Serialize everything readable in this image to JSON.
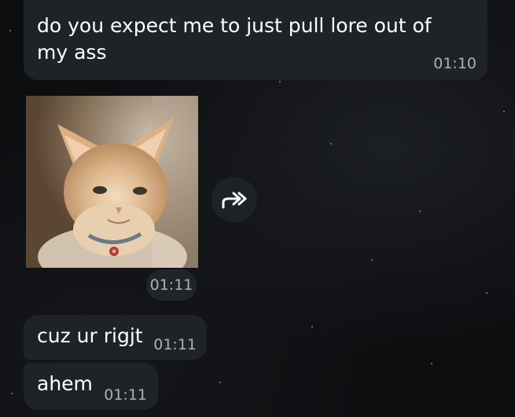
{
  "messages": [
    {
      "text": "do you expect me to just pull lore out of my ass",
      "time": "01:10"
    },
    {
      "time": "01:11"
    },
    {
      "text": "cuz ur rigjt",
      "time": "01:11"
    },
    {
      "text": "ahem",
      "time": "01:11"
    }
  ],
  "icons": {
    "forward": "forward-arrow-icon"
  },
  "colors": {
    "background": "#0d0e10",
    "bubble": "#1f2327",
    "time_text": "#a9b0b8",
    "message_text": "#ffffff"
  }
}
